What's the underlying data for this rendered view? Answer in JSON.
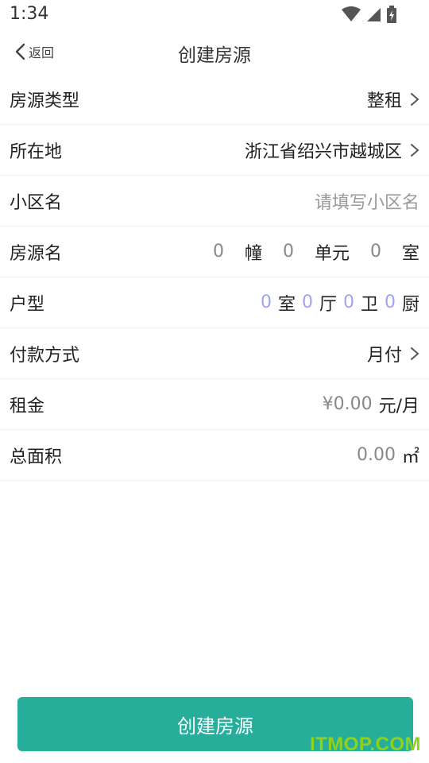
{
  "status_bar": {
    "time": "1:34"
  },
  "nav": {
    "back_label": "返回",
    "title": "创建房源"
  },
  "form": {
    "house_type": {
      "label": "房源类型",
      "value": "整租"
    },
    "location": {
      "label": "所在地",
      "value": "浙江省绍兴市越城区"
    },
    "community": {
      "label": "小区名",
      "placeholder": "请填写小区名"
    },
    "house_name": {
      "label": "房源名",
      "building_num": "0",
      "building_unit": "幢",
      "unit_num": "0",
      "unit_unit": "单元",
      "room_num": "0",
      "room_unit": "室"
    },
    "layout": {
      "label": "户型",
      "room_num": "0",
      "room_unit": "室",
      "hall_num": "0",
      "hall_unit": "厅",
      "bath_num": "0",
      "bath_unit": "卫",
      "kitchen_num": "0",
      "kitchen_unit": "厨"
    },
    "payment": {
      "label": "付款方式",
      "value": "月付"
    },
    "rent": {
      "label": "租金",
      "value": "¥0.00",
      "unit": "元/月"
    },
    "area": {
      "label": "总面积",
      "value": "0.00",
      "unit": "㎡"
    }
  },
  "submit": {
    "label": "创建房源"
  },
  "watermark": "ITMOP.COM",
  "colors": {
    "primary": "#27ae9b",
    "number_accent": "#9fa3ee",
    "watermark": "#8fd11f"
  }
}
